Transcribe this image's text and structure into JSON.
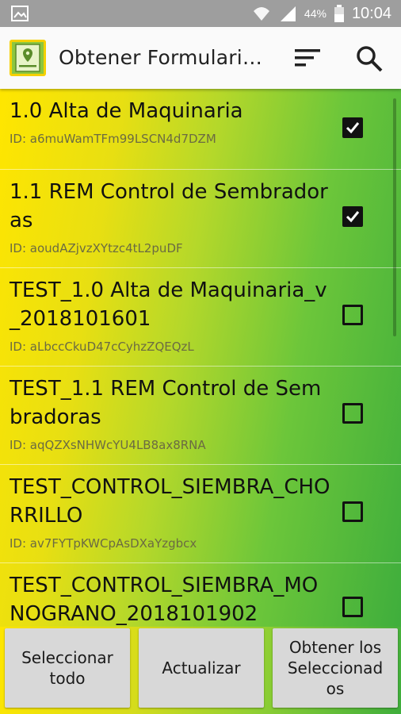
{
  "status_bar": {
    "battery_percent": "44%",
    "time": "10:04",
    "icons": [
      "image-icon",
      "wifi-icon",
      "signal-icon",
      "battery-icon"
    ]
  },
  "app_bar": {
    "title": "Obtener Formularios en Blanco",
    "logo_icon": "map-form-icon",
    "sort_icon": "sort-icon",
    "search_icon": "search-icon"
  },
  "forms": [
    {
      "name": "1.0 Alta de Maquinaria",
      "id": "ID: a6muWamTFm99LSCN4d7DZM",
      "checked": true
    },
    {
      "name": "1.1 REM Control de Sembradoras",
      "id": "ID: aoudAZjvzXYtzc4tL2puDF",
      "checked": true
    },
    {
      "name": "TEST_1.0 Alta de Maquinaria_v_2018101601",
      "id": "ID: aLbccCkuD47cCyhzZQEQzL",
      "checked": false
    },
    {
      "name": "TEST_1.1 REM Control de Sembradoras",
      "id": "ID: aqQZXsNHWcYU4LB8ax8RNA",
      "checked": false
    },
    {
      "name": "TEST_CONTROL_SIEMBRA_CHORRILLO",
      "id": "ID: av7FYTpKWCpAsDXaYzgbcx",
      "checked": false
    },
    {
      "name": "TEST_CONTROL_SIEMBRA_MONOGRANO_2018101902",
      "id": "",
      "checked": false
    }
  ],
  "buttons": {
    "select_all": "Seleccionar todo",
    "refresh": "Actualizar",
    "get_selected": "Obtener los Seleccionados"
  }
}
